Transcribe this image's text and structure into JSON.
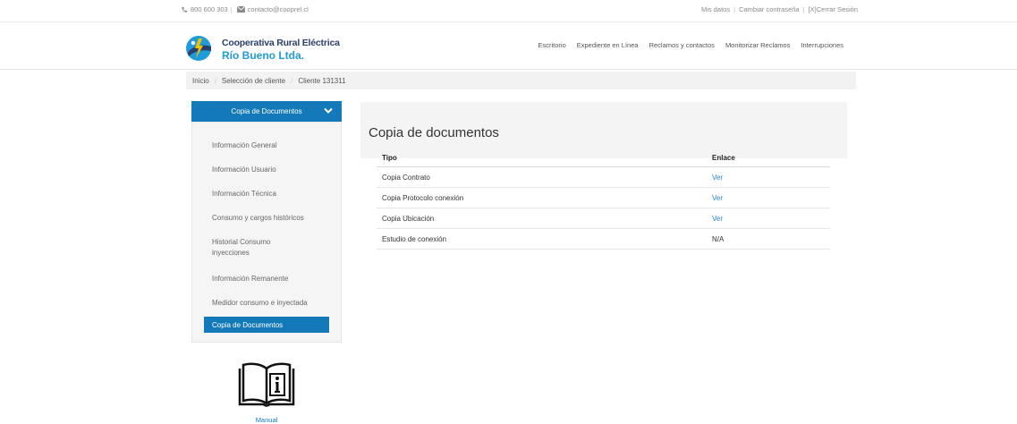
{
  "topbar": {
    "phone": "800 600 303",
    "email": "contacto@cooprel.cl",
    "links": [
      "Mis datos",
      "Cambiar contraseña",
      "[X]Cerrar Sesión"
    ]
  },
  "brand": {
    "line1": "Cooperativa Rural Eléctrica",
    "line2": "Río Bueno Ltda."
  },
  "nav": [
    "Escritorio",
    "Expediente en Línea",
    "Reclamos y contactos",
    "Monitorizar Reclamos",
    "Interrupciones"
  ],
  "breadcrumb": [
    "Inicio",
    "Selección de cliente",
    "Cliente 131311"
  ],
  "sidebar": {
    "header": "Copia de Documentos",
    "items": [
      "Información General",
      "Información Usuario",
      "Información Técnica",
      "Consumo y cargos históricos",
      "Historial Consumo inyecciones",
      "Información Remanente",
      "Medidor consumo e inyectada"
    ],
    "active": "Copia de Documentos"
  },
  "manual": {
    "label": "Manual"
  },
  "content": {
    "title": "Copia de documentos",
    "columns": [
      "Tipo",
      "Enlace"
    ],
    "rows": [
      {
        "tipo": "Copia Contrato",
        "enlace": "Ver"
      },
      {
        "tipo": "Copia Protocolo conexión",
        "enlace": "Ver"
      },
      {
        "tipo": "Copia Ubicación",
        "enlace": "Ver"
      },
      {
        "tipo": "Estudio de conexión",
        "enlace": "N/A"
      }
    ]
  },
  "colors": {
    "primary": "#1479b8",
    "link": "#1f87d0",
    "brand_dark": "#2b3f6d",
    "brand_light": "#1f9bd7"
  }
}
